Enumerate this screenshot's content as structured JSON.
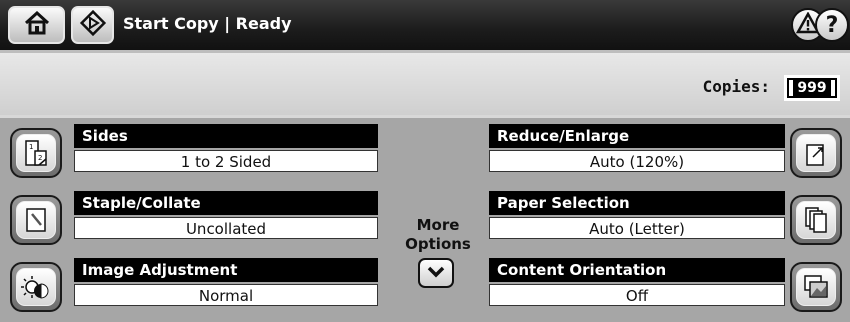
{
  "header": {
    "home_icon": "home-icon",
    "start_icon": "start-diamond-icon",
    "title": "Start Copy | Ready",
    "alert_icon": "warning-icon",
    "help_icon": "help-icon"
  },
  "copies": {
    "label": "Copies:",
    "value": "999"
  },
  "options": {
    "sides": {
      "title": "Sides",
      "value": "1 to 2 Sided",
      "icon": "duplex-page-icon"
    },
    "staple": {
      "title": "Staple/Collate",
      "value": "Uncollated",
      "icon": "staple-icon"
    },
    "image": {
      "title": "Image Adjustment",
      "value": "Normal",
      "icon": "image-adjust-icon"
    },
    "reduce": {
      "title": "Reduce/Enlarge",
      "value": "Auto (120%)",
      "icon": "resize-page-icon"
    },
    "paper": {
      "title": "Paper Selection",
      "value": "Auto (Letter)",
      "icon": "paper-stack-icon"
    },
    "orientation": {
      "title": "Content Orientation",
      "value": "Off",
      "icon": "orientation-icon"
    }
  },
  "more_options": {
    "line1": "More",
    "line2": "Options",
    "icon": "chevron-down-icon"
  }
}
